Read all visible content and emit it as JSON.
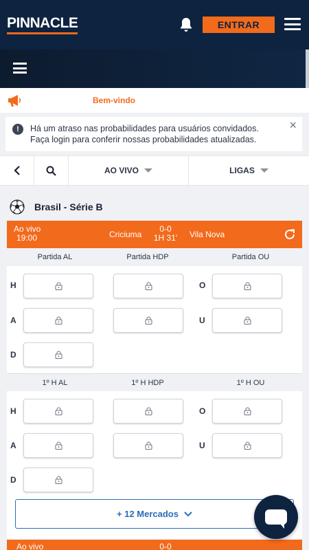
{
  "header": {
    "logo": "PINNACLE",
    "login_label": "ENTRAR"
  },
  "welcome": {
    "text": "Bem-vindo"
  },
  "alert": {
    "line1": "Há um atraso nas probabilidades para usuários convidados.",
    "line2": "Faça login para conferir nossas probabilidades atualizadas.",
    "close": "×"
  },
  "filters": {
    "live_label": "AO VIVO",
    "leagues_label": "LIGAS"
  },
  "league": {
    "name": "Brasil - Série B"
  },
  "match": {
    "status": "Ao vivo",
    "time": "19:00",
    "home": "Criciuma",
    "score": "0-0",
    "clock": "1H 31'",
    "away": "Vila Nova"
  },
  "match2": {
    "status": "Ao vivo",
    "score": "0-0"
  },
  "markets": {
    "full": {
      "col1": "Partida AL",
      "col2": "Partida HDP",
      "col3": "Partida OU"
    },
    "half": {
      "col1": "1º H AL",
      "col2": "1º H HDP",
      "col3": "1º H OU"
    },
    "row_h": "H",
    "row_a": "A",
    "row_d": "D",
    "row_o": "O",
    "row_u": "U"
  },
  "more_markets": "+ 12 Mercados",
  "colors": {
    "brand_navy": "#0d2340",
    "brand_orange": "#f26a1b",
    "link_blue": "#2b6cb7"
  }
}
